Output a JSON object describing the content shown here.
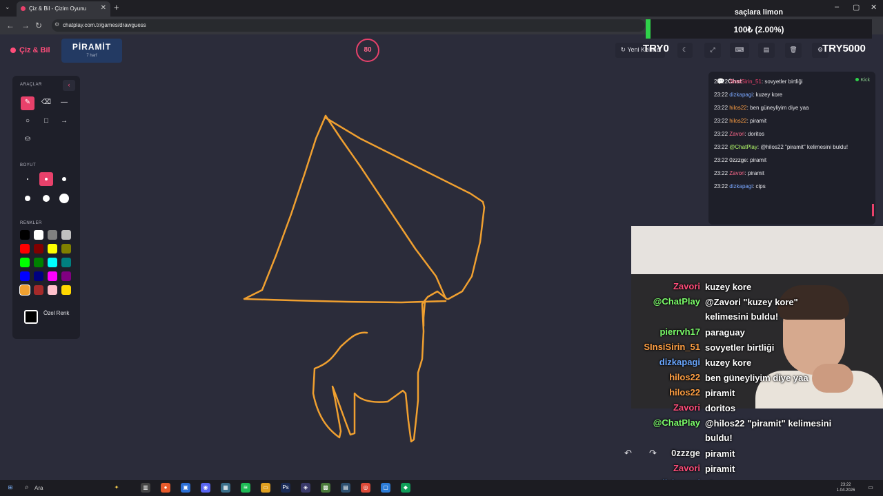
{
  "browser": {
    "tab_title": "Çiz & Bil - Çizim Oyunu",
    "url": "chatplay.com.tr/games/drawguess"
  },
  "header": {
    "logo": "Çiz & Bil",
    "word": "PİRAMİT",
    "word_hint": "7 harf",
    "timer": "80",
    "new_word": "Yeni Kelime"
  },
  "overlay": {
    "donation_title": "saçlara limon",
    "donation_amount": "100₺ (2.00%)",
    "donation_progress": 0.02,
    "try_left": "TRY0",
    "try_right": "TRY5000"
  },
  "tools": {
    "tools_label": "ARAÇLAR",
    "size_label": "BOYUT",
    "colors_label": "RENKLER",
    "custom_color": "Özel Renk",
    "colors": [
      "#000000",
      "#ffffff",
      "#808080",
      "#c0c0c0",
      "#ff0000",
      "#800000",
      "#ffff00",
      "#808000",
      "#00ff00",
      "#008000",
      "#00ffff",
      "#008080",
      "#0000ff",
      "#000080",
      "#ff00ff",
      "#800080",
      "#f0a030",
      "#a52a2a",
      "#ffc0cb",
      "#ffd700"
    ],
    "selected_color": "#f0a030"
  },
  "chat": {
    "title": "Chat",
    "platform": "Kick",
    "messages": [
      {
        "time": "23:22",
        "user": "SinsiSirin_51",
        "color": "#e8416b",
        "text": "sovyetler birtliği"
      },
      {
        "time": "23:22",
        "user": "dizkapagi",
        "color": "#7aa7ff",
        "text": "kuzey kore"
      },
      {
        "time": "23:22",
        "user": "hilos22",
        "color": "#ff9f43",
        "text": "ben güneyliyim diye yaa"
      },
      {
        "time": "23:22",
        "user": "hilos22",
        "color": "#ff9f43",
        "text": "piramit"
      },
      {
        "time": "23:22",
        "user": "Zavori",
        "color": "#ff6a8d",
        "text": "doritos"
      },
      {
        "time": "23:22",
        "user": "@ChatPlay",
        "color": "#b6ff6b",
        "text": "@hilos22 \"piramit\" kelimesini buldu!"
      },
      {
        "time": "23:22",
        "user": "0zzzge",
        "color": "#f0f0f0",
        "text": "piramit"
      },
      {
        "time": "23:22",
        "user": "Zavori",
        "color": "#ff6a8d",
        "text": "piramit"
      },
      {
        "time": "23:22",
        "user": "dizkapagi",
        "color": "#7aa7ff",
        "text": "cips"
      }
    ]
  },
  "stream_chat": [
    {
      "user": "Zavori",
      "color": "#ff4d7a",
      "text": "kuzey kore"
    },
    {
      "user": "@ChatPlay",
      "color": "#7cff6b",
      "text": "@Zavori \"kuzey kore\" kelimesini buldu!"
    },
    {
      "user": "pierrvh17",
      "color": "#7cff6b",
      "text": "paraguay"
    },
    {
      "user": "SInsiSirin_51",
      "color": "#ff9f43",
      "text": "sovyetler birtliği"
    },
    {
      "user": "dizkapagi",
      "color": "#6aa7ff",
      "text": "kuzey kore"
    },
    {
      "user": "hilos22",
      "color": "#ff9f43",
      "text": "ben güneyliyim diye yaa"
    },
    {
      "user": "hilos22",
      "color": "#ff9f43",
      "text": "piramit"
    },
    {
      "user": "Zavori",
      "color": "#ff4d7a",
      "text": "doritos"
    },
    {
      "user": "@ChatPlay",
      "color": "#7cff6b",
      "text": "@hilos22 \"piramit\" kelimesini buldu!"
    },
    {
      "user": "0zzzge",
      "color": "#f0f0f0",
      "text": "piramit"
    },
    {
      "user": "Zavori",
      "color": "#ff4d7a",
      "text": "piramit"
    },
    {
      "user": "dizkapagi",
      "color": "#6aa7ff",
      "text": "cips"
    }
  ],
  "taskbar": {
    "search": "Ara",
    "time": "23:22",
    "date": "1.04.2026"
  },
  "drawing": {
    "stroke_color": "#f0a030"
  }
}
